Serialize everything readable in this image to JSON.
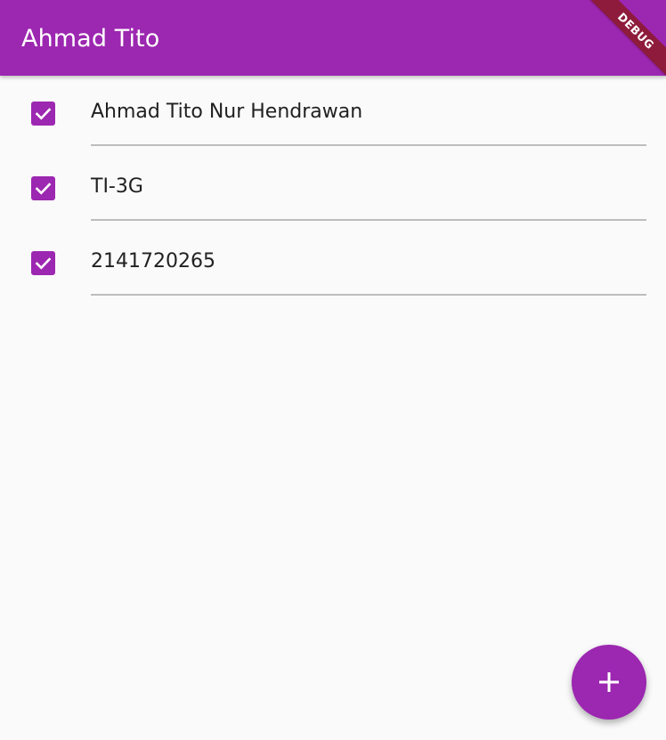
{
  "appbar": {
    "title": "Ahmad Tito",
    "color": "#9c27b0"
  },
  "debug_banner": {
    "label": "DEBUG",
    "color": "#8e1a3c"
  },
  "list": {
    "items": [
      {
        "label": "Ahmad Tito Nur Hendrawan",
        "checked": true
      },
      {
        "label": "TI-3G",
        "checked": true
      },
      {
        "label": "2141720265",
        "checked": true
      }
    ]
  },
  "fab": {
    "icon": "plus-icon",
    "color": "#9c27b0"
  },
  "icons": {
    "checkbox": "check-icon"
  }
}
